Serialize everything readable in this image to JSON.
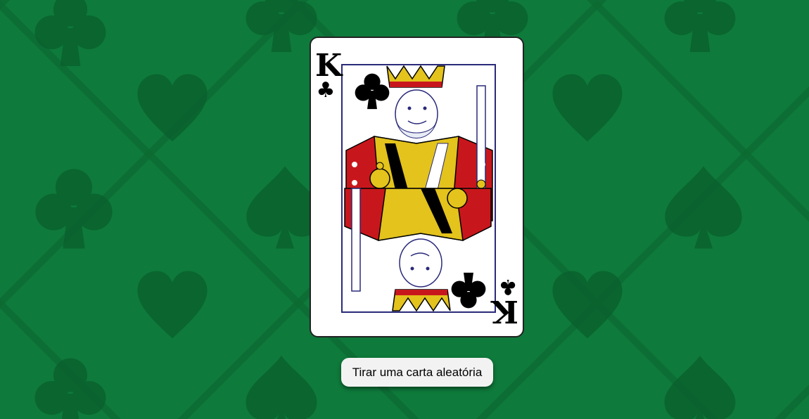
{
  "card": {
    "rank": "K",
    "suit_symbol": "♣",
    "suit_name": "clubs",
    "face": "king"
  },
  "actions": {
    "draw_button_label": "Tirar uma carta aleatória"
  },
  "theme": {
    "felt_color": "#0e7a3b",
    "felt_pattern_color": "#0b6a31",
    "card_border": "#222222",
    "button_bg": "#f2f2f2"
  },
  "background": {
    "pattern_icons": [
      "club-icon",
      "heart-icon",
      "spade-icon"
    ]
  }
}
